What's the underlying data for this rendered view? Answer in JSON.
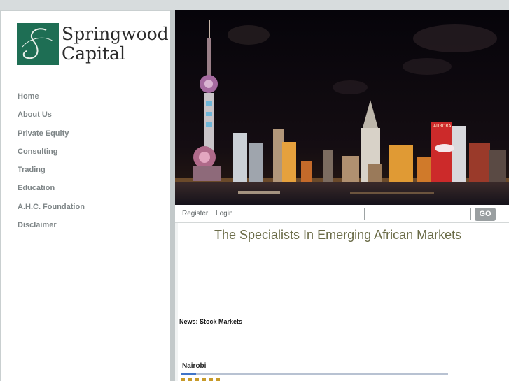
{
  "brand": {
    "name_line1": "Springwood",
    "name_line2": "Capital",
    "monogram": "S",
    "color": "#1e6e54"
  },
  "nav": {
    "items": [
      {
        "label": "Home"
      },
      {
        "label": "About Us"
      },
      {
        "label": "Private Equity"
      },
      {
        "label": "Consulting"
      },
      {
        "label": "Trading"
      },
      {
        "label": "Education"
      },
      {
        "label": "A.H.C. Foundation"
      },
      {
        "label": "Disclaimer"
      }
    ]
  },
  "hero": {
    "description_icon": "city-skyline-night-photo",
    "sign_text": "AURORA"
  },
  "toolbar": {
    "register_label": "Register",
    "login_label": "Login",
    "search_placeholder": "",
    "go_label": "GO"
  },
  "main": {
    "tagline": "The Specialists In Emerging African Markets",
    "news_heading": "News: Stock Markets",
    "city_tab": "Nairobi"
  },
  "colors": {
    "tagline": "#6a6b47",
    "nav_text": "#7e8587",
    "go_button": "#9a9fa1",
    "tab_accent": "#3f74c8"
  }
}
